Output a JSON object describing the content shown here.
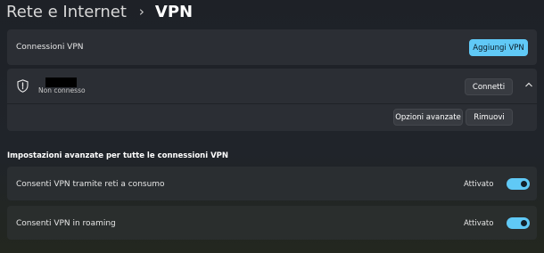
{
  "breadcrumb": {
    "parent": "Rete e Internet",
    "separator": "›",
    "current": "VPN"
  },
  "vpn_header": {
    "label": "Connessioni VPN",
    "add_button": "Aggiungi VPN"
  },
  "connection": {
    "status": "Non connesso",
    "connect_button": "Connetti",
    "advanced_button": "Opzioni avanzate",
    "remove_button": "Rimuovi"
  },
  "advanced": {
    "title": "Impostazioni avanzate per tutte le connessioni VPN",
    "settings": [
      {
        "label": "Consenti VPN tramite reti a consumo",
        "state": "Attivato",
        "on": true
      },
      {
        "label": "Consenti VPN in roaming",
        "state": "Attivato",
        "on": true
      }
    ]
  },
  "colors": {
    "accent": "#60c9f6",
    "card": "#2b2e34",
    "background": "#1f2228"
  },
  "icons": {
    "connection": "shield-icon",
    "expand": "chevron-up-icon",
    "separator": "chevron-right-icon"
  }
}
